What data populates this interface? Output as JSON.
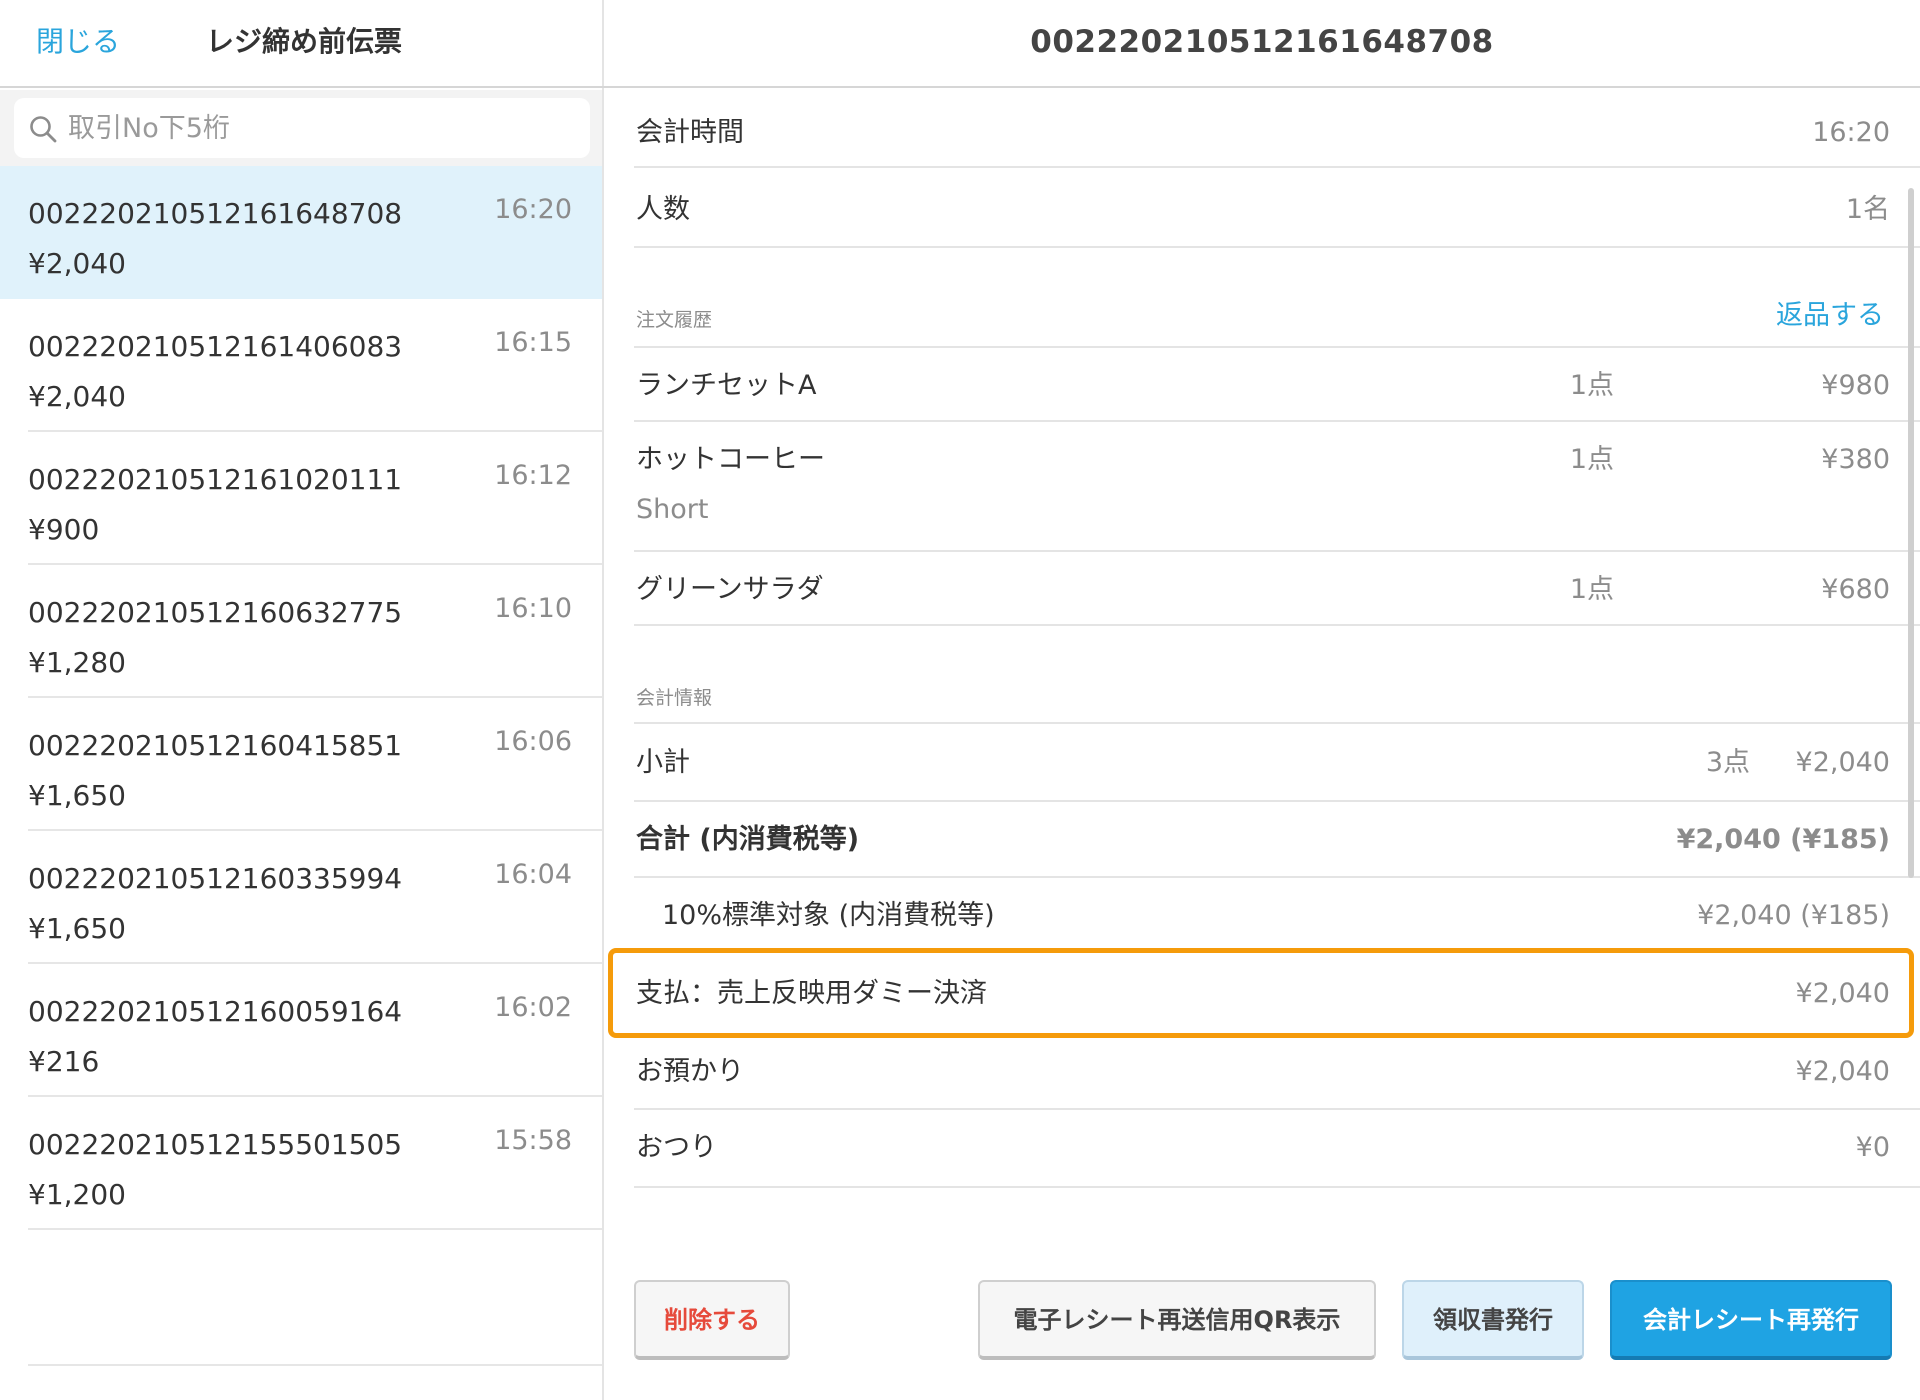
{
  "left_header": {
    "close_label": "閉じる",
    "title": "レジ締め前伝票"
  },
  "search": {
    "placeholder": "取引No下5桁"
  },
  "transactions": [
    {
      "no": "00222021051216164870​8",
      "time": "16:20",
      "amount": "¥2,040"
    },
    {
      "no": "00222021051216140608​3",
      "time": "16:15",
      "amount": "¥2,040"
    },
    {
      "no": "0022202105121610201​11",
      "time": "16:12",
      "amount": "¥900"
    },
    {
      "no": "00222021051216063277​5",
      "time": "16:10",
      "amount": "¥1,280"
    },
    {
      "no": "00222021051216041585​1",
      "time": "16:06",
      "amount": "¥1,650"
    },
    {
      "no": "00222021051216033599​4",
      "time": "16:04",
      "amount": "¥1,650"
    },
    {
      "no": "00222021051216005916​4",
      "time": "16:02",
      "amount": "¥216"
    },
    {
      "no": "00222021051215550150​5",
      "time": "15:58",
      "amount": "¥1,200"
    }
  ],
  "detail": {
    "title": "0022202105121616487​08",
    "checkout_time": {
      "label": "会計時間",
      "value": "16:20"
    },
    "guests": {
      "label": "人数",
      "value": "1名"
    },
    "order_history": {
      "section_label": "注文履歴",
      "return_label": "返品する",
      "items": [
        {
          "name": "ランチセットA",
          "qty": "1点",
          "price": "¥980",
          "option": ""
        },
        {
          "name": "ホットコーヒー",
          "qty": "1点",
          "price": "¥380",
          "option": "Short"
        },
        {
          "name": "グリーンサラダ",
          "qty": "1点",
          "price": "¥680",
          "option": ""
        }
      ]
    },
    "payment_info": {
      "section_label": "会計情報",
      "subtotal": {
        "label": "小計",
        "qty": "3点",
        "value": "¥2,040"
      },
      "total": {
        "label": "合計 (内消費税等)",
        "value": "¥2,040 (¥185)"
      },
      "tax_standard": {
        "label": "10%標準対象 (内消費税等)",
        "value": "¥2,040 (¥185)"
      },
      "payment": {
        "label": "支払：売上反映用ダミー決済",
        "value": "¥2,040"
      },
      "deposit": {
        "label": "お預かり",
        "value": "¥2,040"
      },
      "change": {
        "label": "おつり",
        "value": "¥0"
      }
    }
  },
  "buttons": {
    "delete": "削除する",
    "qr": "電子レシート再送信用QR表示",
    "receipt": "領収書発行",
    "reissue": "会計レシート再発行"
  },
  "colors": {
    "accent": "#2aa5dc",
    "selected_row": "#e0f2fb",
    "highlight": "#f59b0b",
    "danger": "#e64a3b",
    "primary_button": "#1fa3e3"
  }
}
